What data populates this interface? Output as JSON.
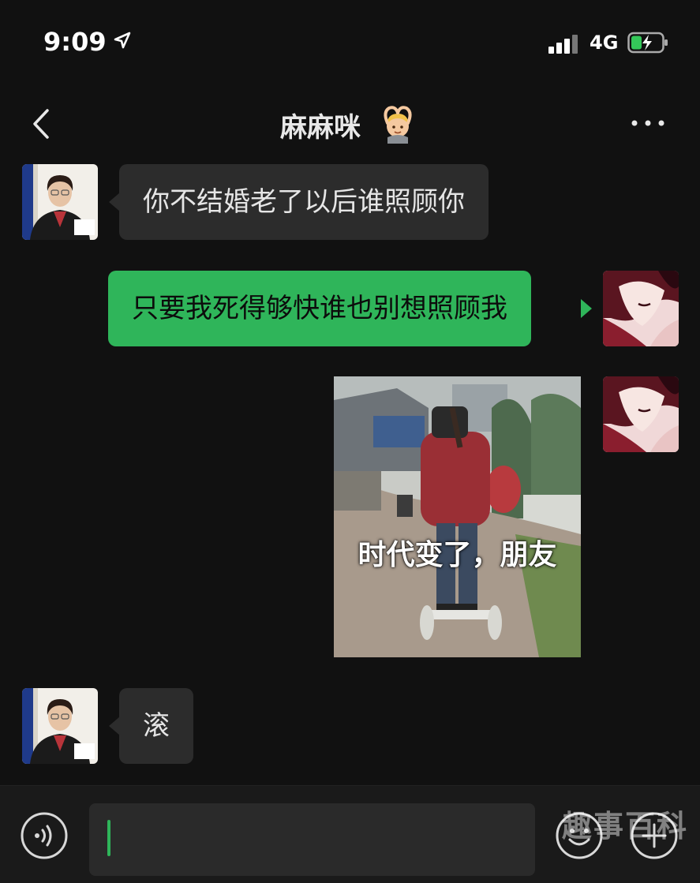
{
  "status_bar": {
    "time": "9:09",
    "network": "4G",
    "battery_state": "charging"
  },
  "nav": {
    "title": "麻麻咪",
    "title_emoji": "person-gesturing-ok",
    "back_icon": "chevron-left-icon",
    "more_icon": "ellipsis-icon"
  },
  "messages": [
    {
      "sender": "other",
      "type": "text",
      "text": "你不结婚老了以后谁照顾你"
    },
    {
      "sender": "me",
      "type": "text",
      "text": "只要我死得够快谁也别想照顾我"
    },
    {
      "sender": "me",
      "type": "sticker",
      "caption": "时代变了，朋友"
    },
    {
      "sender": "other",
      "type": "text",
      "text": "滚"
    }
  ],
  "input_bar": {
    "value": "",
    "voice_icon": "voice-icon",
    "emoji_icon": "emoji-icon",
    "plus_icon": "plus-icon",
    "watermark": "趣事百科"
  },
  "colors": {
    "background": "#111111",
    "incoming_bubble": "#2c2c2c",
    "outgoing_bubble": "#2fb55a",
    "input_bar": "#1a1a1a"
  }
}
